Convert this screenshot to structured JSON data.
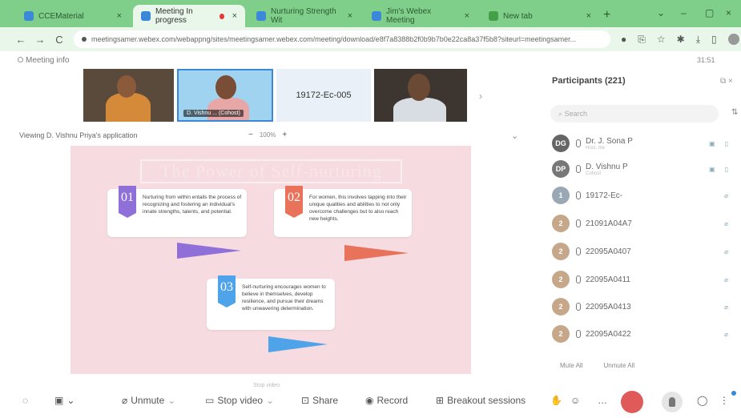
{
  "browser": {
    "tabs": [
      {
        "title": "CCEMaterial",
        "active": false
      },
      {
        "title": "Meeting In progress",
        "active": true
      },
      {
        "title": "Nurturing Strength Wit",
        "active": false
      },
      {
        "title": "Jim's Webex Meeting",
        "active": false
      },
      {
        "title": "New tab",
        "active": false
      }
    ],
    "new_tab": "+",
    "url": "meetingsamer.webex.com/webappng/sites/meetingsamer.webex.com/meeting/download/e8f7a8388b2f0b9b7b0e22ca8a37f5b8?siteurl=meetingsamer..."
  },
  "meeting": {
    "info_label": "Meeting info",
    "clock": "31:51",
    "videos": {
      "name_b": "D. Vishnu ... (Cohost)",
      "label_c": "19172-Ec-005"
    },
    "viewing_label": "Viewing D. Vishnu Priya's application",
    "zoom_out": "−",
    "zoom_pct": "100%",
    "zoom_in": "+"
  },
  "slide": {
    "title": "The Power of Self-nurturing",
    "cards": [
      {
        "num": "01",
        "text": "Nurturing from within entails the process of recognizing and fostering an individual's innate strengths, talents, and potential."
      },
      {
        "num": "02",
        "text": "For women, this involves tapping into their unique qualities and abilities to not only overcome challenges but to also reach new heights."
      },
      {
        "num": "03",
        "text": "Self-nurturing encourages women to believe in themselves, develop resilience, and pursue their dreams with unwavering determination."
      }
    ],
    "colors": {
      "purple": "#8f6fd8",
      "orange": "#e8735a",
      "blue": "#4fa3e8"
    }
  },
  "participants": {
    "title": "Participants (221)",
    "search_placeholder": "Search",
    "items": [
      {
        "initials": "DG",
        "name": "Dr. J. Sona P",
        "sub": "Host, me",
        "color": "#666666"
      },
      {
        "initials": "DP",
        "name": "D. Vishnu P",
        "sub": "Cohost",
        "color": "#777777"
      },
      {
        "initials": "1",
        "name": "19172-Ec-",
        "sub": "",
        "color": "#9aa7b5"
      },
      {
        "initials": "2",
        "name": "21091A04A7",
        "sub": "",
        "color": "#c6a78a"
      },
      {
        "initials": "2",
        "name": "22095A0407",
        "sub": "",
        "color": "#c6a78a"
      },
      {
        "initials": "2",
        "name": "22095A0411",
        "sub": "",
        "color": "#c6a78a"
      },
      {
        "initials": "2",
        "name": "22095A0413",
        "sub": "",
        "color": "#c6a78a"
      },
      {
        "initials": "2",
        "name": "22095A0422",
        "sub": "",
        "color": "#c6a78a"
      }
    ],
    "mute_all": "Mute All",
    "unmute_all": "Unmute All"
  },
  "toolbar": {
    "unmute": "Unmute",
    "stop_video": "Stop video",
    "share": "Share",
    "record": "Record",
    "breakout": "Breakout sessions",
    "hint": "Stop video"
  }
}
